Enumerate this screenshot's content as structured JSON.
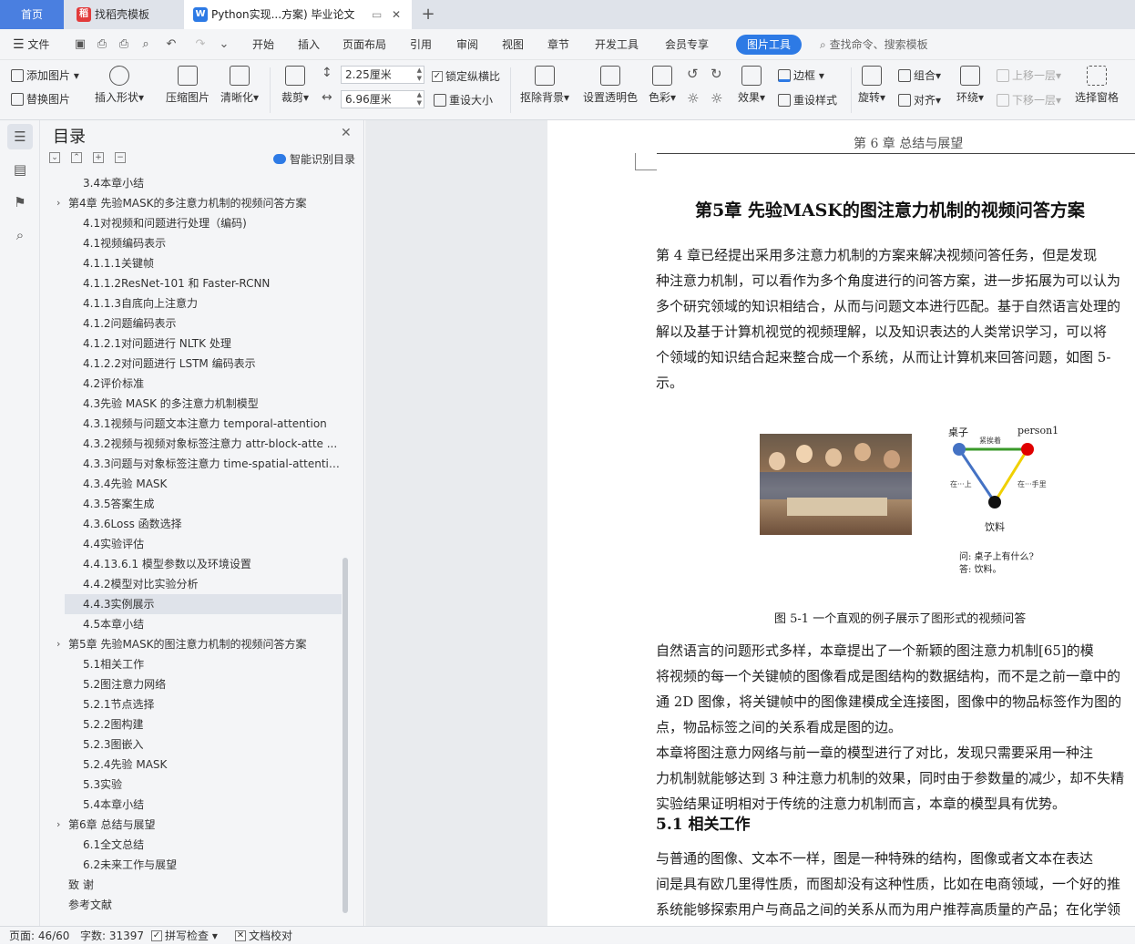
{
  "tabs": {
    "home": "首页",
    "templates": "找稻壳模板",
    "doc": "Python实现...方案) 毕业论文",
    "add": "+"
  },
  "menu": {
    "file": "文件",
    "items": [
      "开始",
      "插入",
      "页面布局",
      "引用",
      "审阅",
      "视图",
      "章节",
      "开发工具",
      "会员专享"
    ],
    "active": "图片工具",
    "search": "查找命令、搜索模板"
  },
  "ribbon": {
    "add_image": "添加图片",
    "replace_image": "替换图片",
    "insert_shape": "插入形状",
    "compress": "压缩图片",
    "clarity": "清晰化",
    "crop": "裁剪",
    "height": "2.25厘米",
    "width": "6.96厘米",
    "lock_ratio": "锁定纵横比",
    "resize": "重设大小",
    "remove_bg": "抠除背景",
    "transparent": "设置透明色",
    "color": "色彩",
    "effects": "效果",
    "border": "边框",
    "reset_style": "重设样式",
    "rotate": "旋转",
    "group": "组合",
    "align": "对齐",
    "wrap": "环绕",
    "bring_forward": "上移一层",
    "send_backward": "下移一层",
    "selection_pane": "选择窗格"
  },
  "toc": {
    "title": "目录",
    "smart": "智能识别目录",
    "items": [
      {
        "text": "3.4本章小结",
        "level": 2
      },
      {
        "text": "第4章  先验MASK的多注意力机制的视频问答方案",
        "level": 1
      },
      {
        "text": "4.1对视频和问题进行处理（编码)",
        "level": 2
      },
      {
        "text": "4.1视频编码表示",
        "level": 2
      },
      {
        "text": "4.1.1.1关键帧",
        "level": 2
      },
      {
        "text": "4.1.1.2ResNet-101 和 Faster-RCNN",
        "level": 2
      },
      {
        "text": "4.1.1.3自底向上注意力",
        "level": 2
      },
      {
        "text": "4.1.2问题编码表示",
        "level": 2
      },
      {
        "text": "4.1.2.1对问题进行 NLTK 处理",
        "level": 2
      },
      {
        "text": "4.1.2.2对问题进行 LSTM 编码表示",
        "level": 2
      },
      {
        "text": "4.2评价标准",
        "level": 2
      },
      {
        "text": "4.3先验 MASK 的多注意力机制模型",
        "level": 2
      },
      {
        "text": "4.3.1视频与问题文本注意力 temporal-attention",
        "level": 2
      },
      {
        "text": "4.3.2视频与视频对象标签注意力  attr-block-atte ...",
        "level": 2
      },
      {
        "text": "4.3.3问题与对象标签注意力  time-spatial-attenti ...",
        "level": 2
      },
      {
        "text": "4.3.4先验 MASK",
        "level": 2
      },
      {
        "text": "4.3.5答案生成",
        "level": 2
      },
      {
        "text": "4.3.6Loss 函数选择",
        "level": 2
      },
      {
        "text": "4.4实验评估",
        "level": 2
      },
      {
        "text": "4.4.13.6.1  模型参数以及环境设置",
        "level": 2
      },
      {
        "text": "4.4.2模型对比实验分析",
        "level": 2
      },
      {
        "text": "4.4.3实例展示",
        "level": 2,
        "selected": true
      },
      {
        "text": "4.5本章小结",
        "level": 2
      },
      {
        "text": "第5章  先验MASK的图注意力机制的视频问答方案",
        "level": 1
      },
      {
        "text": "5.1相关工作",
        "level": 2
      },
      {
        "text": "5.2图注意力网络",
        "level": 2
      },
      {
        "text": "5.2.1节点选择",
        "level": 2
      },
      {
        "text": "5.2.2图构建",
        "level": 2
      },
      {
        "text": "5.2.3图嵌入",
        "level": 2
      },
      {
        "text": "5.2.4先验 MASK",
        "level": 2
      },
      {
        "text": "5.3实验",
        "level": 2
      },
      {
        "text": "5.4本章小结",
        "level": 2
      },
      {
        "text": "第6章  总结与展望",
        "level": 1
      },
      {
        "text": "6.1全文总结",
        "level": 2
      },
      {
        "text": "6.2未来工作与展望",
        "level": 2
      },
      {
        "text": "致  谢",
        "level": 0
      },
      {
        "text": "参考文献",
        "level": 0
      }
    ]
  },
  "doc": {
    "running_header": "第 6 章  总结与展望",
    "chapter_title": "第5章  先验MASK的图注意力机制的视频问答方案",
    "para1": [
      "    第 4 章已经提出采用多注意力机制的方案来解决视频问答任务，但是发现",
      "种注意力机制，可以看作为多个角度进行的问答方案，进一步拓展为可以认为",
      "多个研究领域的知识相结合，从而与问题文本进行匹配。基于自然语言处理的",
      "解以及基于计算机视觉的视频理解，以及知识表达的人类常识学习，可以将",
      "个领域的知识结合起来整合成一个系统，从而让计算机来回答问题，如图 5-",
      "示。"
    ],
    "figure": {
      "node_table": "桌子",
      "node_person": "person1",
      "node_drink": "饮料",
      "edge_top": "紧挨着",
      "edge_left": "在···上",
      "edge_right": "在···手里",
      "question": "问: 桌子上有什么?",
      "answer": "答:  饮料。"
    },
    "caption": "图 5-1  一个直观的例子展示了图形式的视频问答",
    "para2": [
      "    自然语言的问题形式多样，本章提出了一个新颖的图注意力机制[65]的模",
      "将视频的每一个关键帧的图像看成是图结构的数据结构，而不是之前一章中的",
      "通 2D 图像，将关键帧中的图像建模成全连接图，图像中的物品标签作为图的",
      "点，物品标签之间的关系看成是图的边。",
      "    本章将图注意力网络与前一章的模型进行了对比，发现只需要采用一种注",
      "力机制就能够达到 3 种注意力机制的效果，同时由于参数量的减少，却不失精",
      "实验结果证明相对于传统的注意力机制而言，本章的模型具有优势。"
    ],
    "section_heading": "5.1   相关工作",
    "para3": [
      "    与普通的图像、文本不一样，图是一种特殊的结构，图像或者文本在表达",
      "间是具有欧几里得性质，而图却没有这种性质，比如在电商领域，一个好的推",
      "系统能够探索用户与商品之间的关系从而为用户推荐高质量的产品；在化学领"
    ]
  },
  "status": {
    "page": "页面: 46/60",
    "words": "字数: 31397",
    "spell": "拼写检查",
    "proof": "文档校对"
  },
  "colors": {
    "accent": "#2d7ae5",
    "node_blue": "#4472c4",
    "node_red": "#e00000",
    "edge_green": "#3a9a2a",
    "edge_blue": "#4472c4",
    "edge_yellow": "#f0d000"
  }
}
